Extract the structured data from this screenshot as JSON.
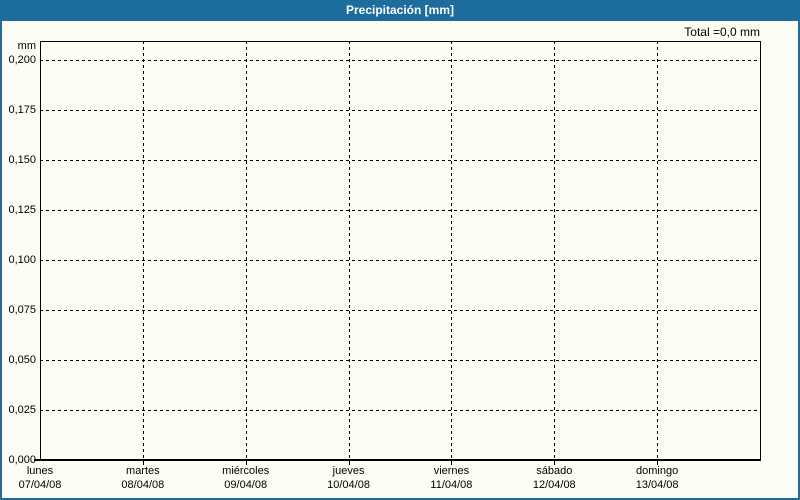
{
  "window": {
    "title": "Precipitación [mm]"
  },
  "summary": {
    "total_label": "Total =0,0 mm"
  },
  "chart_data": {
    "type": "bar",
    "title": "Precipitación [mm]",
    "xlabel": "",
    "ylabel": "mm",
    "ylim": [
      0,
      0.2
    ],
    "y_tick_step": 0.025,
    "y_ticks": [
      0,
      0.025,
      0.05,
      0.075,
      0.1,
      0.125,
      0.15,
      0.175,
      0.2
    ],
    "y_tick_labels": [
      "0,000",
      "0,025",
      "0,050",
      "0,075",
      "0,100",
      "0,125",
      "0,150",
      "0,175",
      "0,200"
    ],
    "categories": [
      {
        "day": "lunes",
        "date": "07/04/08"
      },
      {
        "day": "martes",
        "date": "08/04/08"
      },
      {
        "day": "miércoles",
        "date": "09/04/08"
      },
      {
        "day": "jueves",
        "date": "10/04/08"
      },
      {
        "day": "viernes",
        "date": "11/04/08"
      },
      {
        "day": "sábado",
        "date": "12/04/08"
      },
      {
        "day": "domingo",
        "date": "13/04/08"
      }
    ],
    "series": [
      {
        "name": "Precipitación",
        "values": [
          0,
          0,
          0,
          0,
          0,
          0,
          0
        ]
      }
    ],
    "total": "0,0 mm",
    "grid": true,
    "grid_style": "dashed",
    "legend_position": "none",
    "decimal_separator": ","
  },
  "colors": {
    "header_bg": "#1d6c9e",
    "panel_border": "#1d6c9e",
    "panel_bg": "#fdfdf6",
    "title_text": "#ffffff",
    "axis_text": "#000000",
    "grid_line": "#000000"
  }
}
